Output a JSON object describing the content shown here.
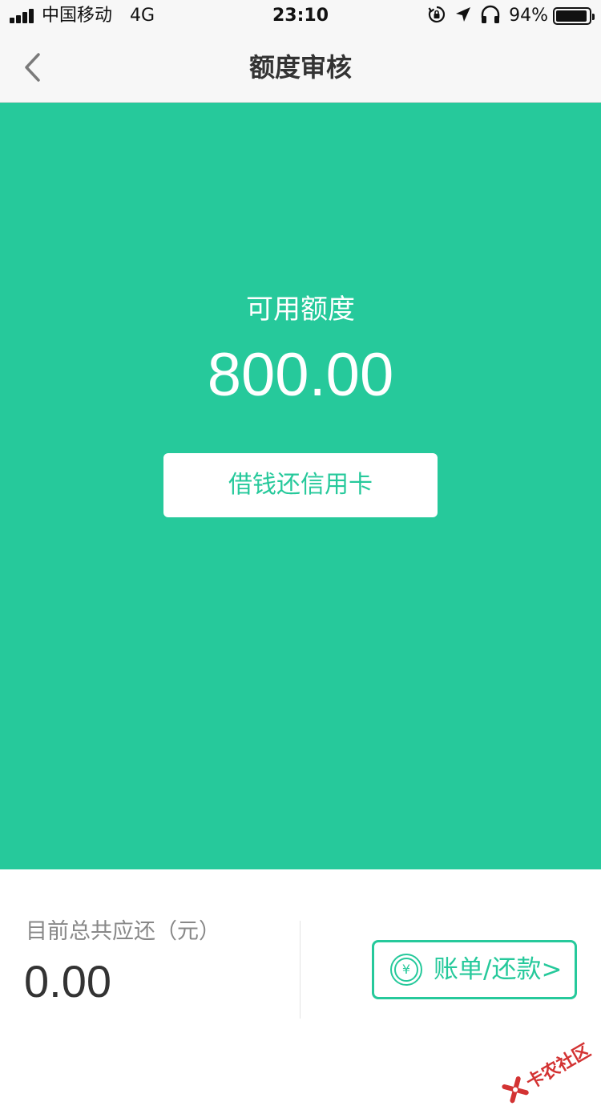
{
  "status_bar": {
    "carrier": "中国移动",
    "network": "4G",
    "time": "23:10",
    "battery_percent": "94%",
    "battery_level": 0.94,
    "icons": [
      "signal-icon",
      "orientation-lock-icon",
      "location-arrow-icon",
      "headphones-icon",
      "battery-icon"
    ]
  },
  "nav": {
    "title": "额度审核",
    "back_icon": "chevron-left-icon"
  },
  "credit": {
    "label": "可用额度",
    "amount": "800.00",
    "button_label": "借钱还信用卡"
  },
  "summary": {
    "due_label": "目前总共应还（元）",
    "due_amount": "0.00",
    "bill_button_label": "账单/还款>",
    "bill_icon": "yen-circle-icon",
    "yen_symbol": "¥"
  },
  "watermark": {
    "text": "卡农社区"
  },
  "colors": {
    "brand_green": "#26c99b",
    "nav_background": "#f7f7f7",
    "title_text": "#333333",
    "muted_text": "#888888",
    "watermark_red": "#d33333"
  }
}
